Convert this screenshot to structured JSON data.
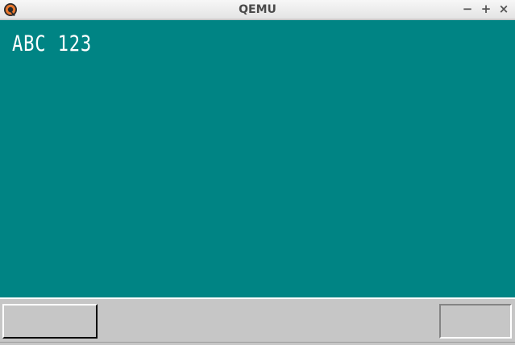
{
  "window": {
    "title": "QEMU",
    "icon": "qemu-logo-icon",
    "controls": {
      "minimize": "−",
      "maximize": "+",
      "close": "×"
    }
  },
  "screen": {
    "background_color": "#008484",
    "text": "ABC 123",
    "text_color": "#ffffff"
  },
  "taskbar": {
    "background_color": "#c6c6c6",
    "start_button_label": "",
    "tray_label": ""
  }
}
